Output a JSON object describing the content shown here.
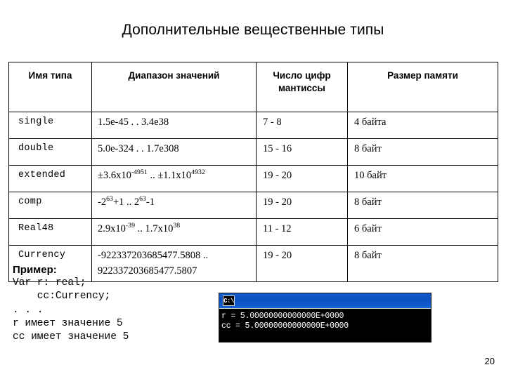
{
  "slide": {
    "title": "Дополнительные вещественные типы",
    "page_number": "20"
  },
  "table": {
    "headers": {
      "name": "Имя типа",
      "range": "Диапазон значений",
      "digits_line1": "Число цифр",
      "digits_line2": "мантиссы",
      "memory": "Размер памяти"
    },
    "rows": [
      {
        "type": "single",
        "range_text": "1.5e-45 . . 3.4e38",
        "digits": "7 - 8",
        "memory": "4 байта"
      },
      {
        "type": "double",
        "range_text": "5.0e-324 . . 1.7e308",
        "digits": "15 - 16",
        "memory": "8 байт"
      },
      {
        "type": "extended",
        "range_text": "±3.6x10-4951 .. ±1.1x104932",
        "range_parts": {
          "a_base": "±3.6x10",
          "a_exp": "-4951",
          "sep": " .. ",
          "b_base": "±1.1x10",
          "b_exp": "4932"
        },
        "digits": "19 - 20",
        "memory": "10 байт"
      },
      {
        "type": "comp",
        "range_text": "-263+1 .. 263-1",
        "range_parts": {
          "a_base": "-2",
          "a_exp": "63",
          "a_tail": "+1",
          "sep": " .. ",
          "b_base": "2",
          "b_exp": "63",
          "b_tail": "-1"
        },
        "digits": "19 - 20",
        "memory": "8 байт"
      },
      {
        "type": "Real48",
        "range_text": "2.9x10-39 .. 1.7x1038",
        "range_parts": {
          "a_base": "2.9x10",
          "a_exp": "-39",
          "sep": " .. ",
          "b_base": "1.7x10",
          "b_exp": "38"
        },
        "digits": "11 - 12",
        "memory": "6 байт"
      },
      {
        "type": "Currency",
        "range_line1": "-922337203685477.5808  ..",
        "range_line2": "922337203685477.5807",
        "digits": "19 - 20",
        "memory": "8 байт"
      }
    ]
  },
  "example": {
    "label": "Пример:",
    "code": "Var r: real;\n    cc:Currency;\n. . .\nr имеет значение 5\ncc имеет значение 5"
  },
  "console": {
    "icon_label": "C:\\",
    "line1": "r = 5.00000000000000E+0000",
    "line2": "cc = 5.00000000000000E+0000"
  }
}
